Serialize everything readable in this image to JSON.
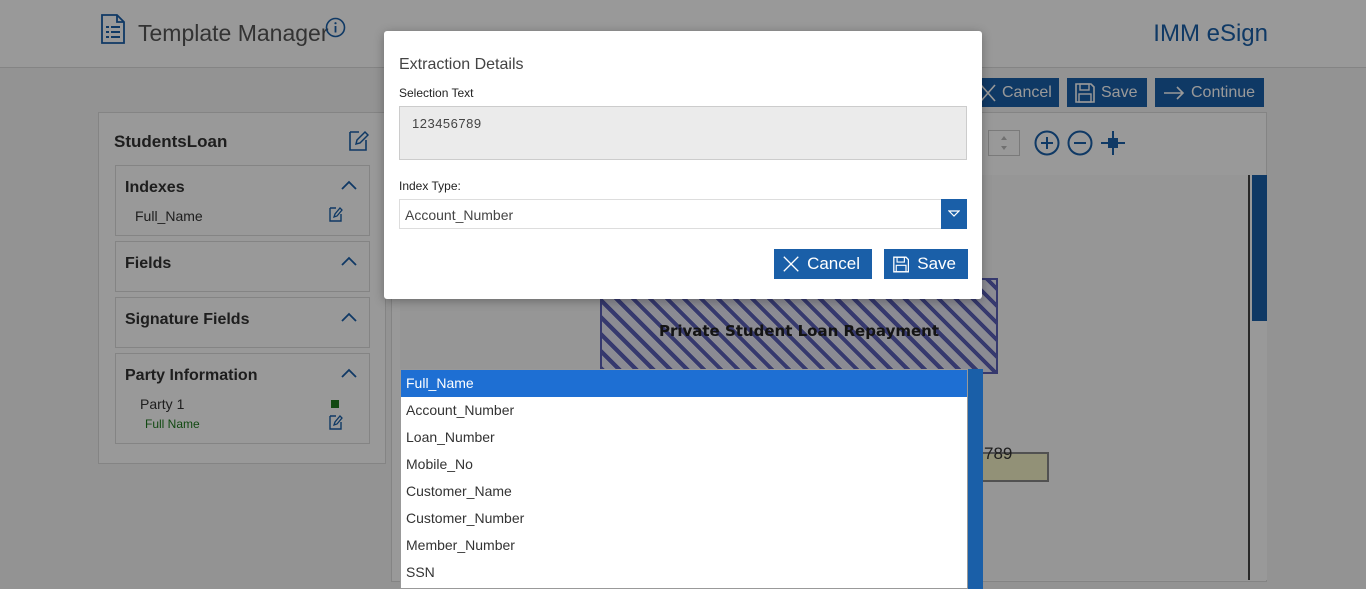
{
  "header": {
    "title": "Template Manager",
    "brand": "IMM eSign"
  },
  "toolbar": {
    "cancel_label": "Cancel",
    "save_label": "Save",
    "continue_label": "Continue"
  },
  "left_panel": {
    "template_name": "StudentsLoan",
    "sections": {
      "indexes": {
        "title": "Indexes",
        "items": [
          "Full_Name"
        ]
      },
      "fields": {
        "title": "Fields"
      },
      "signature_fields": {
        "title": "Signature Fields"
      },
      "party_information": {
        "title": "Party Information",
        "party": "Party 1",
        "party_color": "#1e7b1e",
        "party_field": "Full Name"
      }
    }
  },
  "document": {
    "title_text": "Private Student Loan Repayment",
    "field_text": "789"
  },
  "modal": {
    "title": "Extraction Details",
    "selection_label": "Selection Text",
    "selection_value": "123456789",
    "index_type_label": "Index Type:",
    "index_type_value": "Account_Number",
    "cancel_label": "Cancel",
    "save_label": "Save"
  },
  "dropdown": {
    "options": [
      "Full_Name",
      "Account_Number",
      "Loan_Number",
      "Mobile_No",
      "Customer_Name",
      "Customer_Number",
      "Member_Number",
      "SSN"
    ],
    "highlighted": "Full_Name"
  },
  "colors": {
    "accent": "#1a5fa8",
    "highlight": "#1e6fd3",
    "party_green": "#1e7b1e"
  }
}
